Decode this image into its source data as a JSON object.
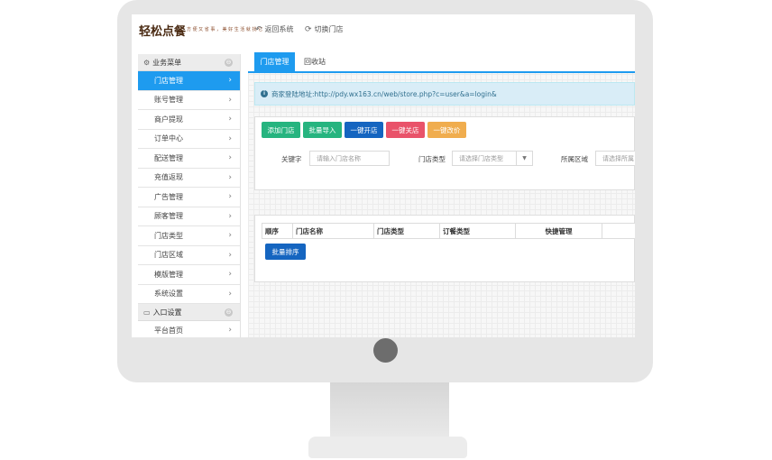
{
  "header": {
    "logo": "轻松点餐",
    "slogan": "方 便 又 省 事 ， 美 好 生 活 就 找 它",
    "links": [
      {
        "icon": "back-arrow-icon",
        "glyph": "↶",
        "label": "返回系统"
      },
      {
        "icon": "refresh-icon",
        "glyph": "⟳",
        "label": "切换门店"
      }
    ]
  },
  "sidebar": {
    "groups": [
      {
        "label": "业务菜单",
        "icon": "gear-icon",
        "glyph": "⚙",
        "toggle": "⊖",
        "items": [
          {
            "label": "门店管理",
            "active": true
          },
          {
            "label": "账号管理",
            "active": false
          },
          {
            "label": "商户提现",
            "active": false
          },
          {
            "label": "订单中心",
            "active": false
          },
          {
            "label": "配送管理",
            "active": false
          },
          {
            "label": "充值返现",
            "active": false
          },
          {
            "label": "广告管理",
            "active": false
          },
          {
            "label": "顾客管理",
            "active": false
          },
          {
            "label": "门店类型",
            "active": false
          },
          {
            "label": "门店区域",
            "active": false
          },
          {
            "label": "模版管理",
            "active": false
          },
          {
            "label": "系统设置",
            "active": false
          }
        ]
      },
      {
        "label": "入口设置",
        "icon": "monitor-icon",
        "glyph": "▭",
        "toggle": "⊖",
        "items": [
          {
            "label": "平台首页",
            "active": false
          }
        ]
      }
    ],
    "arrow": "›"
  },
  "main": {
    "tabs": [
      {
        "label": "门店管理",
        "active": true
      },
      {
        "label": "回收站",
        "active": false
      }
    ],
    "info": {
      "icon_glyph": "i",
      "text": "商家登陆地址:http://pdy.wx163.cn/web/store.php?c=user&a=login&"
    },
    "buttons": [
      {
        "label": "添加门店",
        "color": "#26b47f"
      },
      {
        "label": "批量导入",
        "color": "#26b47f"
      },
      {
        "label": "一键开店",
        "color": "#1565c0"
      },
      {
        "label": "一键关店",
        "color": "#e9536a"
      },
      {
        "label": "一键改价",
        "color": "#f0ad4e"
      }
    ],
    "filters": {
      "keyword_label": "关键字",
      "keyword_placeholder": "请输入门店名称",
      "type_label": "门店类型",
      "type_value": "请选择门店类型",
      "area_label": "所属区域",
      "area_value": "请选择所属",
      "caret": "▼"
    },
    "table": {
      "columns": [
        "顺序",
        "门店名称",
        "门店类型",
        "订餐类型",
        "快捷管理"
      ],
      "sort_button": "批量排序"
    }
  }
}
